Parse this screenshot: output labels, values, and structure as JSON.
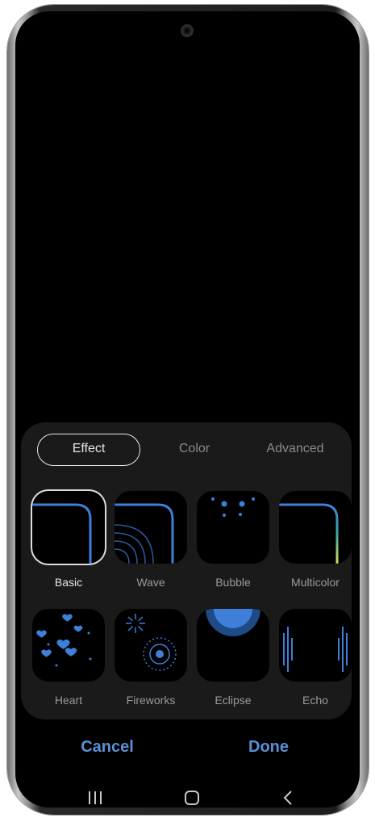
{
  "tabs": [
    {
      "label": "Effect",
      "active": true
    },
    {
      "label": "Color",
      "active": false
    },
    {
      "label": "Advanced",
      "active": false
    }
  ],
  "effects": [
    {
      "label": "Basic",
      "selected": true
    },
    {
      "label": "Wave",
      "selected": false
    },
    {
      "label": "Bubble",
      "selected": false
    },
    {
      "label": "Multicolor",
      "selected": false
    },
    {
      "label": "Heart",
      "selected": false
    },
    {
      "label": "Fireworks",
      "selected": false
    },
    {
      "label": "Eclipse",
      "selected": false
    },
    {
      "label": "Echo",
      "selected": false
    }
  ],
  "actions": {
    "cancel": "Cancel",
    "done": "Done"
  },
  "colors": {
    "accent": "#3d7fd9",
    "button_text": "#5c8fd6",
    "panel": "#1a1a1a"
  },
  "nav_icons": [
    "recents-icon",
    "home-icon",
    "back-icon"
  ]
}
